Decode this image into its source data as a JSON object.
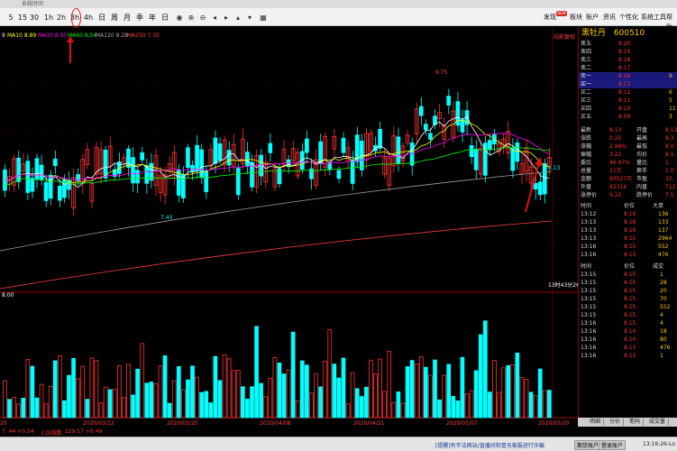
{
  "window": {
    "title": "系统时间"
  },
  "toolbar": {
    "periods": [
      "5",
      "15",
      "30",
      "1h",
      "2h",
      "3h",
      "4h",
      "日",
      "周",
      "月",
      "季",
      "年",
      "日"
    ],
    "right_menu": [
      "发现",
      "板块",
      "账户",
      "资讯",
      "个性化",
      "系统工具",
      "帮助"
    ],
    "new_badge": "NEW"
  },
  "ma_legend": {
    "prefix": "9",
    "ma10": "MA10 8.89",
    "ma30": "MA30 8.93",
    "ma60": "MA60 8.54",
    "ma120": "MA120 8.28",
    "ma250": "MA250 7.35"
  },
  "chart": {
    "corner_label": "向前复权",
    "high_label": "9.75",
    "low_label": "7.43",
    "last_label": "8.13",
    "time_label": "13时43分26秒",
    "vol_label": "8.00",
    "dates": [
      "20",
      "2020/03/12",
      "2020/03/25",
      "2020/04/08",
      "2020/04/21",
      "2020/05/07",
      "2020/05/20"
    ]
  },
  "stock": {
    "name": "黑牡丹",
    "code": "600510"
  },
  "orderbook": {
    "asks": [
      {
        "label": "卖五",
        "price": "8.20",
        "vol": ""
      },
      {
        "label": "卖四",
        "price": "8.19",
        "vol": ""
      },
      {
        "label": "卖三",
        "price": "8.18",
        "vol": ""
      },
      {
        "label": "卖二",
        "price": "8.17",
        "vol": ""
      },
      {
        "label": "卖一",
        "price": "8.16",
        "vol": "9"
      }
    ],
    "selected_row": {
      "label": "买一",
      "price": "8.13",
      "vol": ""
    },
    "bids": [
      {
        "label": "买二",
        "price": "8.12",
        "vol": "6"
      },
      {
        "label": "买三",
        "price": "8.11",
        "vol": "5"
      },
      {
        "label": "买四",
        "price": "8.10",
        "vol": "11"
      },
      {
        "label": "买五",
        "price": "8.09",
        "vol": "3"
      }
    ]
  },
  "quote": {
    "rows": [
      {
        "k1": "最新",
        "v1": "8.13",
        "k2": "开盘",
        "v2": "8.13"
      },
      {
        "k1": "涨跌",
        "v1": "0.25",
        "k2": "最高",
        "v2": "8.3"
      },
      {
        "k1": "涨幅",
        "v1": "2.98%",
        "k2": "最低",
        "v2": "8.0"
      },
      {
        "k1": "振幅",
        "v1": "3.22",
        "k2": "均价",
        "v2": "8.1"
      },
      {
        "k1": "委比",
        "v1": "46.97%",
        "k2": "量比",
        "v2": "1."
      },
      {
        "k1": "总量",
        "v1": "11万",
        "k2": "换手",
        "v2": "1.0"
      },
      {
        "k1": "金额",
        "v1": "93527万",
        "k2": "市盈",
        "v2": "10."
      },
      {
        "k1": "涨停价",
        "v1": "",
        "k2": "跌停价",
        "v2": ""
      },
      {
        "k1": "外盘",
        "v1": "42314",
        "k2": "内盘",
        "v2": "711"
      },
      {
        "k1": "涨停价",
        "v1": "9.22",
        "k2": "跌停价",
        "v2": "7.5"
      }
    ]
  },
  "ticks_header": {
    "time": "时间",
    "price": "价位",
    "vol": "大单"
  },
  "ticks_top": [
    {
      "t": "13:12",
      "p": "8.19",
      "v": "136"
    },
    {
      "t": "13:13",
      "p": "8.18",
      "v": "133"
    },
    {
      "t": "13:13",
      "p": "8.18",
      "v": "137"
    },
    {
      "t": "13:13",
      "p": "8.15",
      "v": "2964"
    },
    {
      "t": "13:16",
      "p": "8.15",
      "v": "552"
    },
    {
      "t": "13:16",
      "p": "8.13",
      "v": "476"
    }
  ],
  "ticks_header2": {
    "time": "时间",
    "price": "价位",
    "vol": "成交"
  },
  "ticks_bottom": [
    {
      "t": "13:15",
      "p": "8.15",
      "v": "1"
    },
    {
      "t": "13:15",
      "p": "8.15",
      "v": "28"
    },
    {
      "t": "13:15",
      "p": "8.15",
      "v": "20"
    },
    {
      "t": "13:15",
      "p": "8.15",
      "v": "70"
    },
    {
      "t": "13:15",
      "p": "8.15",
      "v": "552"
    },
    {
      "t": "13:15",
      "p": "8.15",
      "v": "4"
    },
    {
      "t": "13:16",
      "p": "8.15",
      "v": "4"
    },
    {
      "t": "13:16",
      "p": "8.14",
      "v": "18"
    },
    {
      "t": "13:16",
      "p": "8.14",
      "v": "80"
    },
    {
      "t": "13:16",
      "p": "8.13",
      "v": "476"
    },
    {
      "t": "13:16",
      "p": "8.13",
      "v": "1"
    }
  ],
  "tabs": [
    "明细",
    "分价",
    "笔码",
    "成交量"
  ],
  "leftstrip": {
    "a": "7. 44 +0.54",
    "b": "CDI指数",
    "c": "129.57 +0.49"
  },
  "statusbar": {
    "notice": "[提醒]有不法网站/直播间和冒充客服进行诈骗",
    "btn1": "期货账户",
    "btn2": "登录账户",
    "time": "13:16:26-Lo",
    "logo": "证信通"
  },
  "colors": {
    "up": "#ff3232",
    "down": "#00ffff",
    "ma5": "#ffffff",
    "ma10": "#ffff00",
    "ma30": "#ff00ff",
    "ma60": "#00ff00",
    "ma120": "#a0a0a0",
    "ma250": "#ff4040"
  }
}
